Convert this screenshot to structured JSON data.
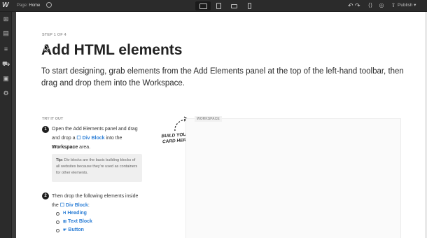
{
  "topbar": {
    "logo": "W",
    "page_prefix": "Page:",
    "page_name": "Home",
    "devices": [
      "desktop",
      "tablet",
      "mobile-landscape",
      "mobile-portrait"
    ],
    "undo_icon": "↶",
    "redo_icon": "↷",
    "publish_label": "Publish"
  },
  "left_toolbar": {
    "items": [
      "add-elements-icon",
      "pages-icon",
      "cms-icon",
      "ecommerce-icon",
      "assets-icon",
      "settings-icon"
    ]
  },
  "lesson": {
    "step": "STEP 1 OF 4",
    "title": "Add HTML elements",
    "intro": "To start designing, grab elements from the Add Elements panel at the top of the left-hand toolbar, then drag and drop them into the Workspace.",
    "try_label": "TRY IT OUT",
    "step1_num": "1",
    "step1_a": "Open the Add Elements panel and drag and drop a ",
    "step1_link": "☐ Div Block",
    "step1_b": " into the ",
    "step1_bold": "Workspace",
    "step1_c": " area.",
    "tip_label": "Tip:",
    "tip_text": " Div blocks are the basic building blocks of all websites because they're used as containers for other elements.",
    "step2_num": "2",
    "step2_a": "Then drop the following elements inside the ",
    "step2_link": "☐ Div Block",
    "step2_b": ":",
    "elements": [
      {
        "icon": "H",
        "label": "Heading"
      },
      {
        "icon": "⊞",
        "label": "Text Block"
      },
      {
        "icon": "☛",
        "label": "Button"
      }
    ],
    "build_note": "BUILD YOUR CARD HERE",
    "workspace_label": "WORKSPACE"
  }
}
